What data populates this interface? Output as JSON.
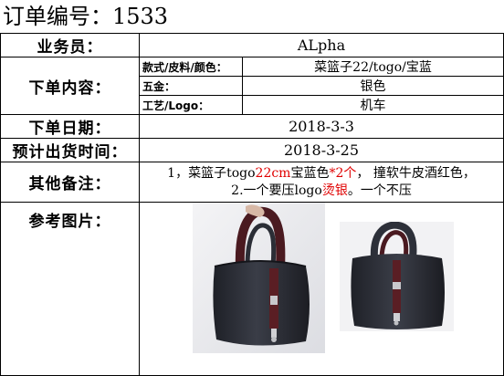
{
  "order": {
    "title_label": "订单编号：",
    "number": "1533"
  },
  "fields": {
    "salesperson": {
      "label": "业务员：",
      "value": "ALpha"
    },
    "content": {
      "label": "下单内容：",
      "rows": [
        {
          "label": "款式/皮料/颜色：",
          "value": "菜篮子22/togo/宝蓝"
        },
        {
          "label": "五金：",
          "value": "银色"
        },
        {
          "label": "工艺/Logo：",
          "value": "机车"
        }
      ]
    },
    "order_date": {
      "label": "下单日期：",
      "value": "2018-3-3"
    },
    "ship_date": {
      "label": "预计出货时间：",
      "value": "2018-3-25"
    },
    "remarks": {
      "label": "其他备注：",
      "line1": {
        "p1": "1，菜篮子togo",
        "p2": "22cm",
        "p3": "宝蓝色",
        "p4": "*2个",
        "p5": "， 撞软牛皮酒红色，"
      },
      "line2": {
        "p1": "2.一个要压logo",
        "p2": "烫银",
        "p3": "。一个不压"
      }
    },
    "reference": {
      "label": "参考图片："
    }
  },
  "colors": {
    "highlight_red": "#e00000",
    "bag_body": "#2b2e36",
    "bag_strap": "#5a1e24",
    "hardware_silver": "#c8c8cc"
  }
}
